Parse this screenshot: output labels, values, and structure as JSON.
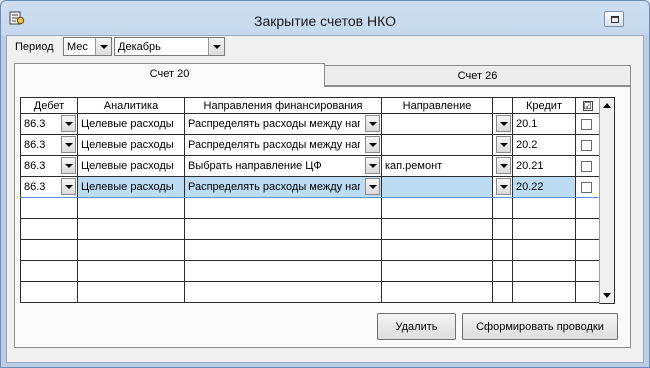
{
  "window": {
    "title": "Закрытие счетов НКО",
    "icon": "app-icon"
  },
  "period": {
    "label": "Период",
    "type_value": "Мес",
    "month_value": "Декабрь"
  },
  "tabs": [
    {
      "label": "Счет 20",
      "active": true
    },
    {
      "label": "Счет 26",
      "active": false
    }
  ],
  "grid": {
    "columns": [
      "Дебет",
      "Аналитика",
      "Направления финансирования",
      "Направление",
      "",
      "Кредит",
      "☑"
    ],
    "rows": [
      {
        "debet": "86.3",
        "analytics": "Целевые расходы",
        "funding": "Распределять расходы между направлениями",
        "direction": "",
        "credit": "20.1",
        "checked": false,
        "selected": false
      },
      {
        "debet": "86.3",
        "analytics": "Целевые расходы",
        "funding": "Распределять расходы между направлениями",
        "direction": "",
        "credit": "20.2",
        "checked": false,
        "selected": false
      },
      {
        "debet": "86.3",
        "analytics": "Целевые расходы",
        "funding": "Выбрать направление ЦФ",
        "direction": "кап.ремонт",
        "credit": "20.21",
        "checked": false,
        "selected": false
      },
      {
        "debet": "86.3",
        "analytics": "Целевые расходы",
        "funding": "Распределять расходы между направлениями",
        "direction": "",
        "credit": "20.22",
        "checked": false,
        "selected": true
      }
    ],
    "empty_rows": 5
  },
  "buttons": {
    "delete_label": "Удалить",
    "generate_label": "Сформировать проводки"
  }
}
